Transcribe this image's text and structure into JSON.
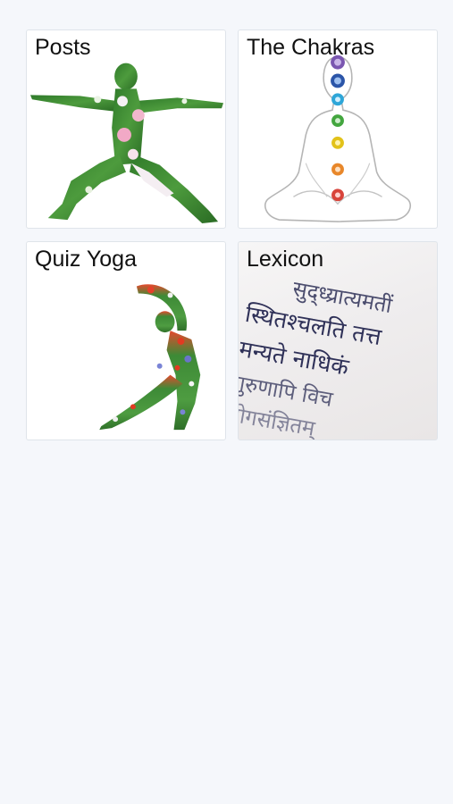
{
  "tiles": [
    {
      "label": "Posts",
      "icon": "warrior-pose-icon"
    },
    {
      "label": "The Chakras",
      "icon": "chakras-icon"
    },
    {
      "label": "Quiz Yoga",
      "icon": "dancer-pose-icon"
    },
    {
      "label": "Lexicon",
      "icon": "sanskrit-text-image"
    }
  ],
  "colors": {
    "background": "#f5f7fb",
    "tile_background": "#ffffff",
    "label_text": "#111111"
  }
}
